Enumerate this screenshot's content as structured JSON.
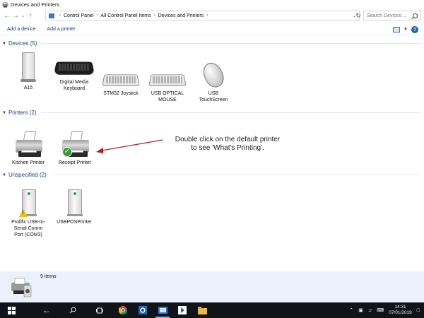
{
  "window": {
    "title": "Devices and Printers"
  },
  "address": {
    "crumbs": [
      "Control Panel",
      "All Control Panel Items",
      "Devices and Printers"
    ],
    "search_placeholder": "Search Devices ..."
  },
  "commands": {
    "add_device": "Add a device",
    "add_printer": "Add a printer"
  },
  "groups": {
    "devices": {
      "title": "Devices (5)",
      "items": [
        "A15",
        "Digital Media Keyboard",
        "STM32 Joystick",
        "USB OPTICAL MOUSE",
        "USB TouchScreen"
      ]
    },
    "printers": {
      "title": "Printers (2)",
      "items": [
        "Kitchen Printer",
        "Receipt Printer"
      ]
    },
    "unspecified": {
      "title": "Unspecified (2)",
      "items": [
        "Prolific USB-to-Serial Comm Port (COM3)",
        "USBPOSPrinter"
      ]
    }
  },
  "annotation": {
    "line1": "Double click on the default printer",
    "line2": "to see 'What's Printing'."
  },
  "details": {
    "count": "9 items"
  },
  "taskbar": {
    "time": "14:31",
    "date": "07/01/2019"
  },
  "colors": {
    "accent": "#1e3d7a",
    "details_bg": "#eaf1fb",
    "taskbar_bg": "#101317",
    "arrow": "#c0161c",
    "default_check": "#2f9c3a"
  }
}
